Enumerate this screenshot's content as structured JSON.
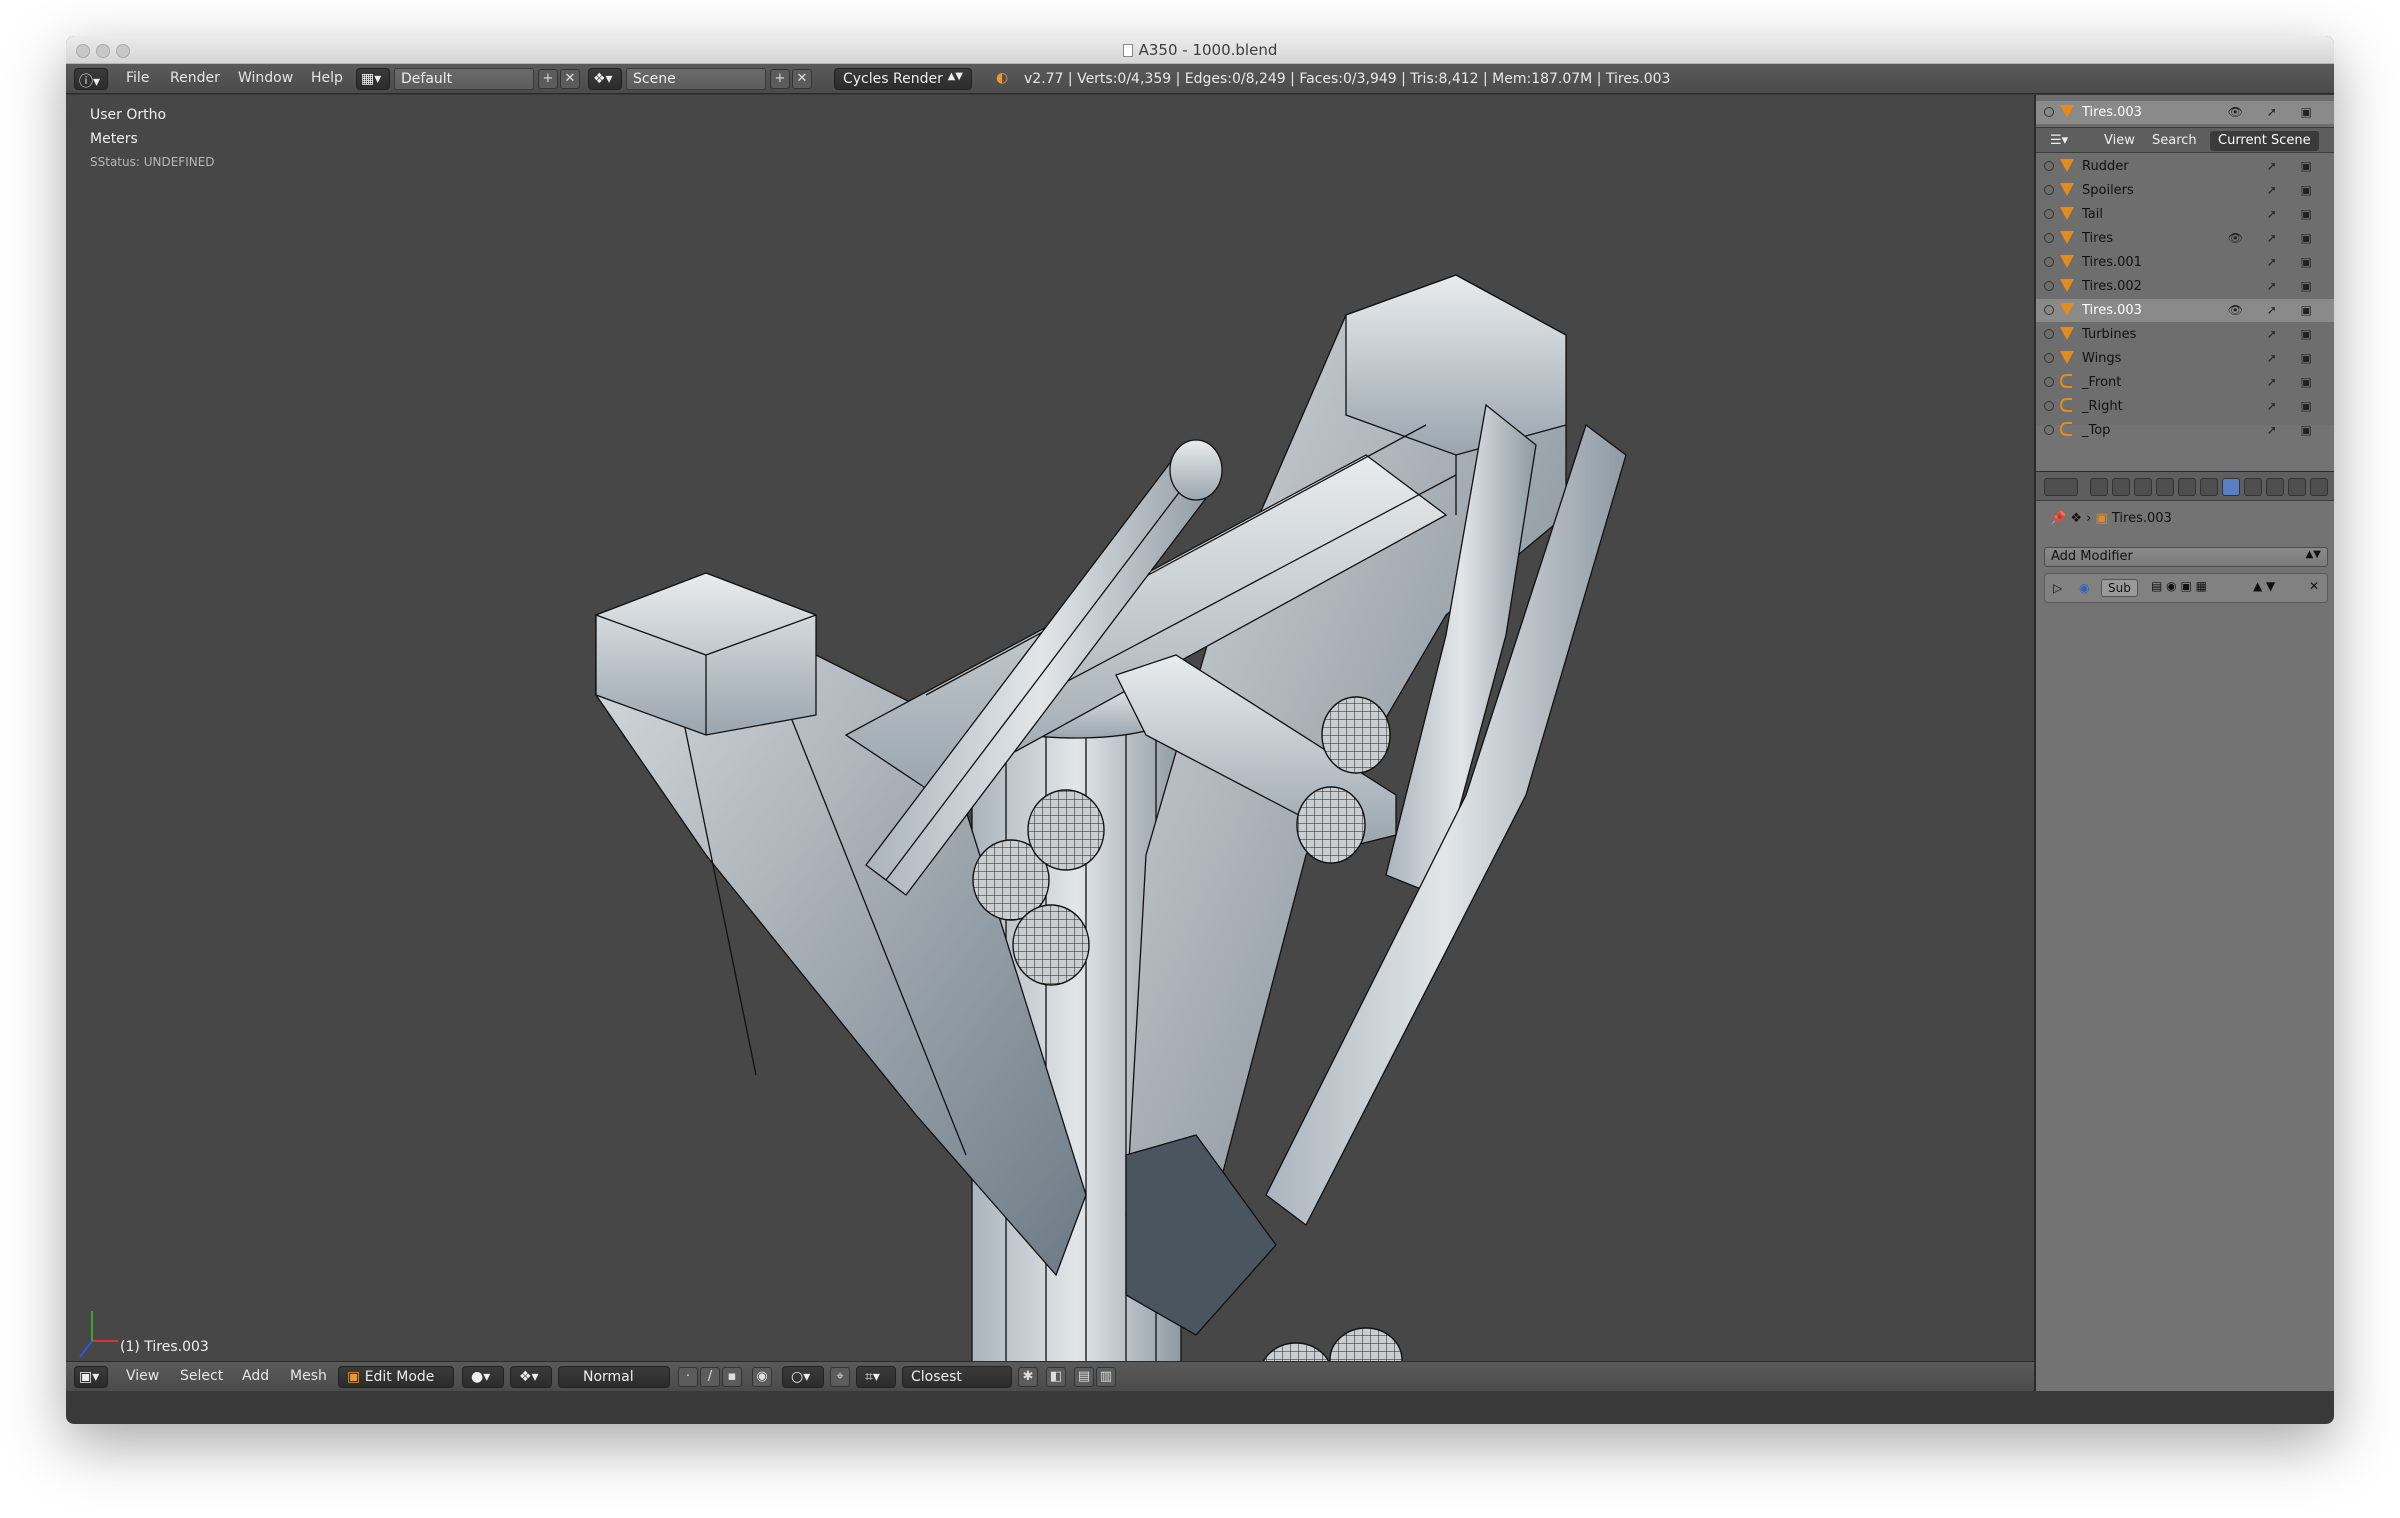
{
  "window": {
    "title": "A350 - 1000.blend"
  },
  "menu": {
    "items": [
      "File",
      "Render",
      "Window",
      "Help"
    ]
  },
  "topbar": {
    "layout": "Default",
    "scene": "Scene",
    "render_engine": "Cycles Render",
    "stats": "v2.77 | Verts:0/4,359 | Edges:0/8,249 | Faces:0/3,949 | Tris:8,412 | Mem:187.07M | Tires.003"
  },
  "viewport": {
    "view_name": "User Ortho",
    "units": "Meters",
    "status": "SStatus: UNDEFINED",
    "object_label": "(1) Tires.003"
  },
  "bottombar": {
    "menus": [
      "View",
      "Select",
      "Add",
      "Mesh"
    ],
    "mode": "Edit Mode",
    "orientation": "Normal",
    "snap": "Closest"
  },
  "outliner": {
    "top_item": "Tires.003",
    "tabs": [
      "View",
      "Search",
      "Current Scene"
    ],
    "items": [
      {
        "label": "Rudder",
        "kind": "mesh"
      },
      {
        "label": "Spoilers",
        "kind": "mesh"
      },
      {
        "label": "Tail",
        "kind": "mesh"
      },
      {
        "label": "Tires",
        "kind": "mesh"
      },
      {
        "label": "Tires.001",
        "kind": "mesh"
      },
      {
        "label": "Tires.002",
        "kind": "mesh"
      },
      {
        "label": "Tires.003",
        "kind": "mesh",
        "selected": true
      },
      {
        "label": "Turbines",
        "kind": "mesh"
      },
      {
        "label": "Wings",
        "kind": "mesh"
      },
      {
        "label": "_Front",
        "kind": "camera"
      },
      {
        "label": "_Right",
        "kind": "camera"
      },
      {
        "label": "_Top",
        "kind": "camera"
      }
    ]
  },
  "properties": {
    "breadcrumb": "Tires.003",
    "add_modifier": "Add Modifier",
    "modifier_name": "Sub"
  }
}
